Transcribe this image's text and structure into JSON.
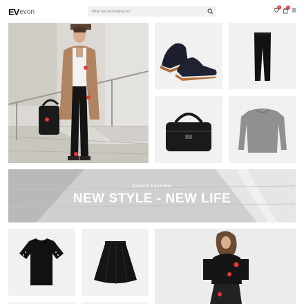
{
  "header": {
    "logo_mark": "EV",
    "logo_text": "evon",
    "search_placeholder": "What are you looking for?",
    "wishlist_count": "0",
    "cart_count": "0"
  },
  "banner": {
    "subtitle": "EVON'S FASHION",
    "title": "NEW STYLE - NEW LIFE"
  },
  "icons": [
    "search-icon",
    "wishlist-icon",
    "cart-icon",
    "menu-icon"
  ],
  "colors": {
    "badge": "#e53935",
    "brand": "#111111"
  }
}
